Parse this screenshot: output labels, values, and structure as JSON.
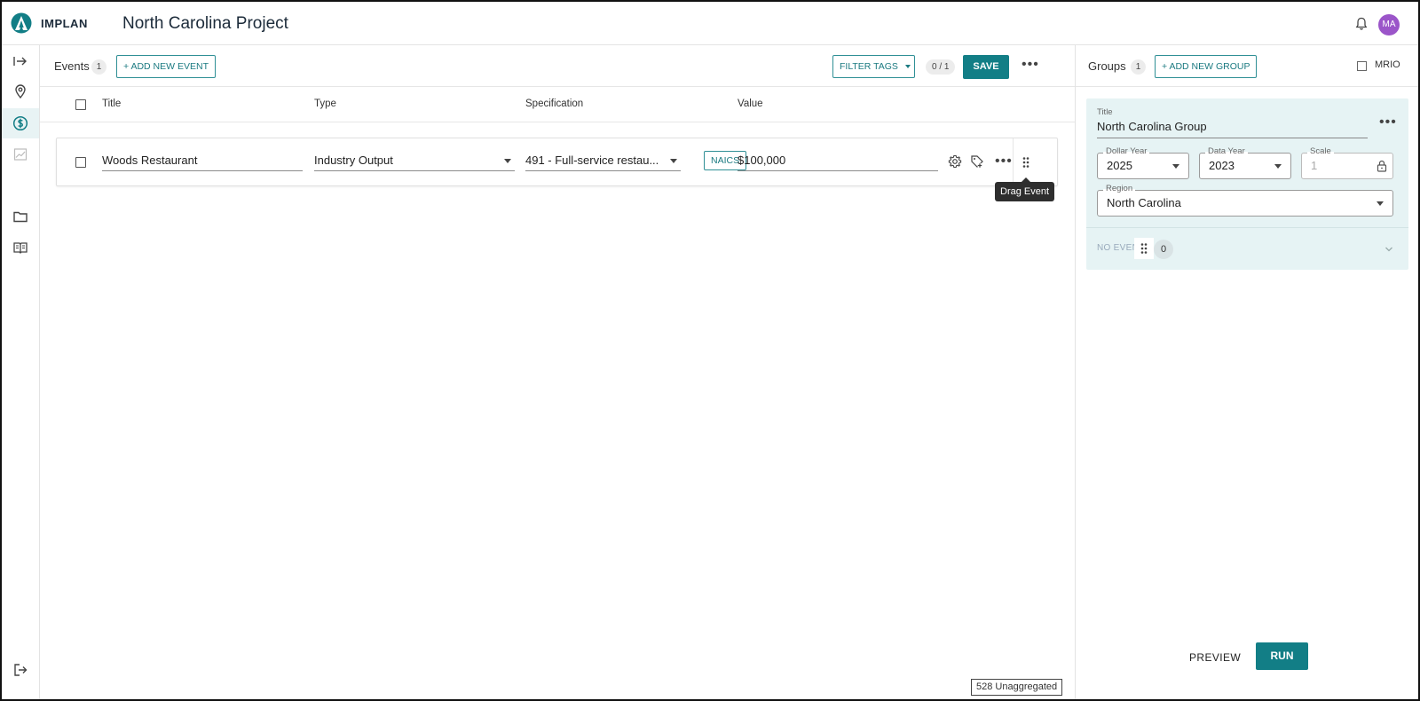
{
  "header": {
    "brand": "IMPLAN",
    "project_title": "North Carolina Project",
    "avatar_initials": "MA",
    "brand_color": "#127e86",
    "avatar_color": "#9b55c9"
  },
  "rail": {
    "icons": [
      "expand-arrow-icon",
      "map-pin-icon",
      "dollar-icon",
      "chart-icon",
      "folder-icon",
      "book-icon",
      "logout-icon"
    ],
    "active": "dollar-icon"
  },
  "events": {
    "label": "Events",
    "count": "1",
    "add_button": "+ ADD NEW EVENT",
    "filter_tags": "FILTER TAGS",
    "selected_ratio": "0 / 1",
    "save": "SAVE",
    "columns": [
      "Title",
      "Type",
      "Specification",
      "Value"
    ],
    "rows": [
      {
        "title": "Woods Restaurant",
        "type": "Industry Output",
        "specification": "491 - Full-service restau...",
        "code_system": "NAICS",
        "value": "$100,000"
      }
    ],
    "tooltip": "Drag Event",
    "unaggregated": "528 Unaggregated"
  },
  "groups": {
    "label": "Groups",
    "count": "1",
    "add_button": "+ ADD NEW GROUP",
    "mrio_label": "MRIO",
    "card": {
      "title_label": "Title",
      "title": "North Carolina Group",
      "dollar_year_label": "Dollar Year",
      "dollar_year": "2025",
      "data_year_label": "Data Year",
      "data_year": "2023",
      "scale_label": "Scale",
      "scale": "1",
      "region_label": "Region",
      "region": "North Carolina",
      "no_events": "NO EVEN",
      "events_count": "0"
    },
    "preview": "PREVIEW",
    "run": "RUN"
  }
}
